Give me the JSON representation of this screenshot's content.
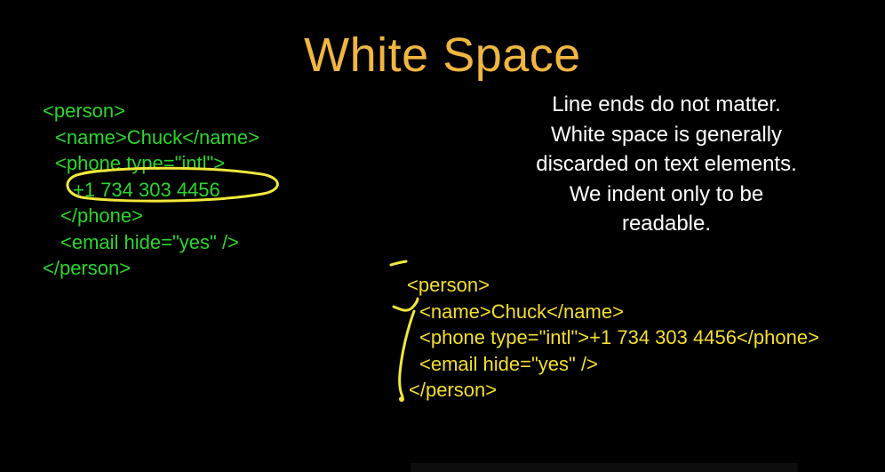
{
  "slide": {
    "title": "White Space",
    "title_color": "#f0b640",
    "background": "#000000"
  },
  "green_code": {
    "color": "#2bd62b",
    "lines": [
      "<person>",
      "<name>Chuck</name>",
      "<phone type=\"intl\">",
      "+1 734 303 4456",
      "</phone>",
      "<email hide=\"yes\" />",
      "</person>"
    ]
  },
  "note": {
    "color": "#ffffff",
    "lines": [
      "Line ends do not matter.",
      "White space is generally",
      "discarded on text elements.",
      "We indent only to be",
      "readable."
    ]
  },
  "yellow_code": {
    "color": "#f5df2e",
    "lines": [
      "<person>",
      "<name>Chuck</name>",
      "<phone type=\"intl\">+1 734 303 4456</phone>",
      "<email hide=\"yes\" />",
      "</person>"
    ]
  },
  "annotation_color": "#f2e83a"
}
